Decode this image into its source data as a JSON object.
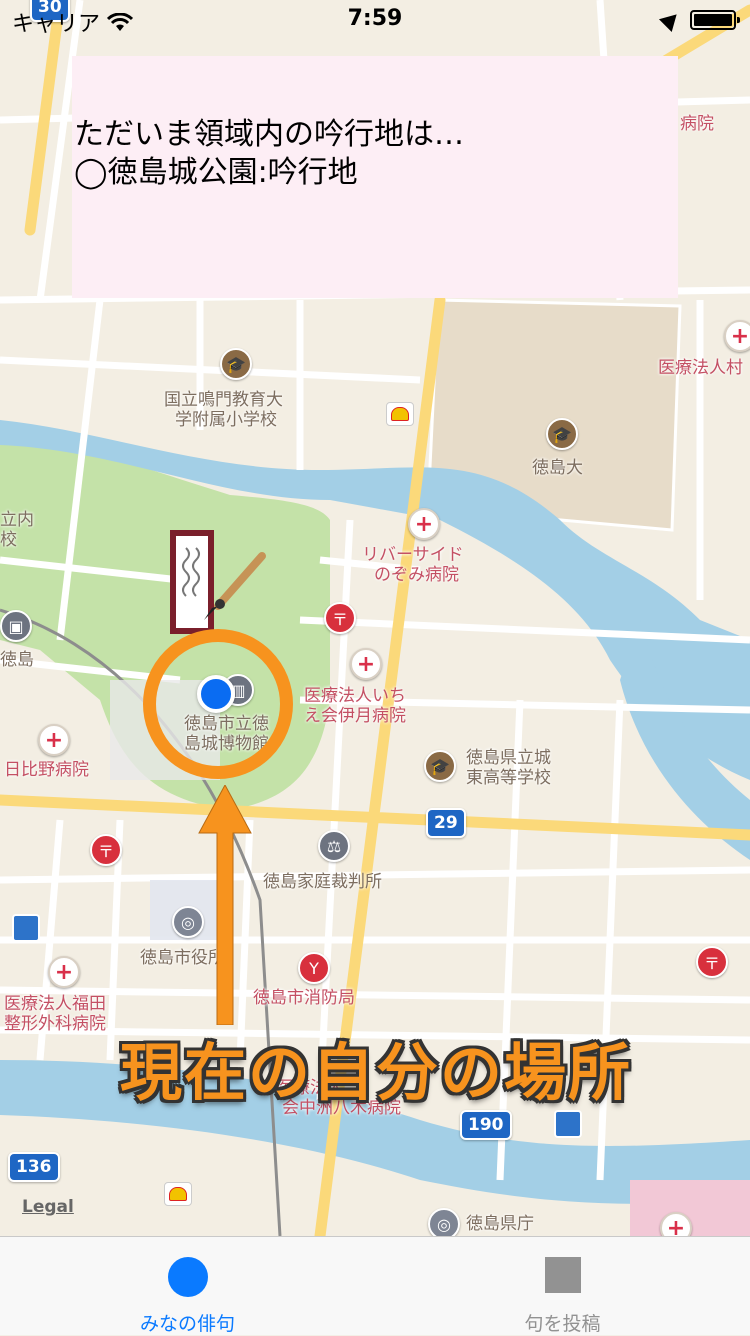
{
  "status_bar": {
    "carrier": "キャリア",
    "time": "7:59"
  },
  "info_panel": {
    "line1": "ただいま領域内の吟行地は…",
    "line2": "◯徳島城公園:吟行地"
  },
  "map": {
    "labels": {
      "hospital_top": "病院",
      "iryohojin_right": "医療法人村",
      "school_line1": "国立鳴門教育大",
      "school_line2": "学附属小学校",
      "univ": "徳島大",
      "left_school_1": "立内",
      "left_school_2": "校",
      "river_side_1": "リバーサイド",
      "river_side_2": "のぞみ病院",
      "station_left": "徳島",
      "iryo_ichi_1": "医療法人いち",
      "iryo_ichi_2": "え会伊月病院",
      "museum_1": "徳島市立徳",
      "museum_2": "島城博物館",
      "hibino": "日比野病院",
      "joto_1": "徳島県立城",
      "joto_2": "東高等学校",
      "court": "徳島家庭裁判所",
      "city_hall": "徳島市役所",
      "fire_station": "徳島市消防局",
      "fukuda_1": "医療法人福田",
      "fukuda_2": "整形外科病院",
      "nakasu_1": "医療法人",
      "nakasu_2": "会中洲八木病院",
      "pref_office": "徳島県庁"
    },
    "routes": {
      "r29": "29",
      "r190": "190",
      "r136": "136",
      "r30": "30"
    },
    "legal": "Legal"
  },
  "annotation": {
    "caption": "現在の自分の場所"
  },
  "tab_bar": {
    "tabs": [
      {
        "label": "みなの俳句",
        "icon": "circle-icon",
        "selected": true
      },
      {
        "label": "句を投稿",
        "icon": "square-icon",
        "selected": false
      }
    ]
  },
  "colors": {
    "accent": "#0a7aff",
    "annotation": "#f7931e",
    "panel_bg": "#fdeef5",
    "park": "#c4e2a8",
    "water": "#a3cfe6",
    "road_major": "#fbd97a"
  }
}
